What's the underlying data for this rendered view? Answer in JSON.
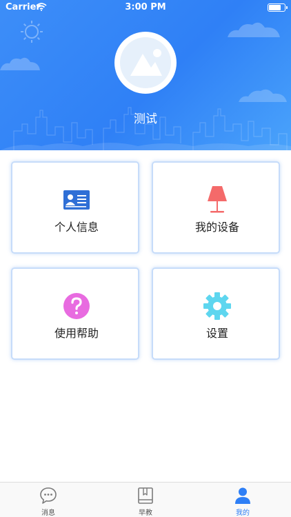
{
  "status_bar": {
    "carrier": "Carrier",
    "time": "3:00 PM",
    "battery_level": 0.85
  },
  "profile": {
    "avatar_icon": "image-placeholder-icon",
    "username": "测试"
  },
  "menu": [
    {
      "label": "个人信息",
      "icon": "id-card-icon",
      "color": "#2f6fd6"
    },
    {
      "label": "我的设备",
      "icon": "lamp-icon",
      "color": "#f46a6a"
    },
    {
      "label": "使用帮助",
      "icon": "help-circle-icon",
      "color": "#e86be0"
    },
    {
      "label": "设置",
      "icon": "gear-icon",
      "color": "#5ed6ef"
    }
  ],
  "tabbar": [
    {
      "label": "消息",
      "icon": "chat-bubble-icon",
      "active": false
    },
    {
      "label": "早教",
      "icon": "book-icon",
      "active": false
    },
    {
      "label": "我的",
      "icon": "person-icon",
      "active": true
    }
  ],
  "colors": {
    "header_blue": "#2f80f6",
    "active_tab": "#2e7ff6",
    "card_border": "#c6dcfa"
  }
}
